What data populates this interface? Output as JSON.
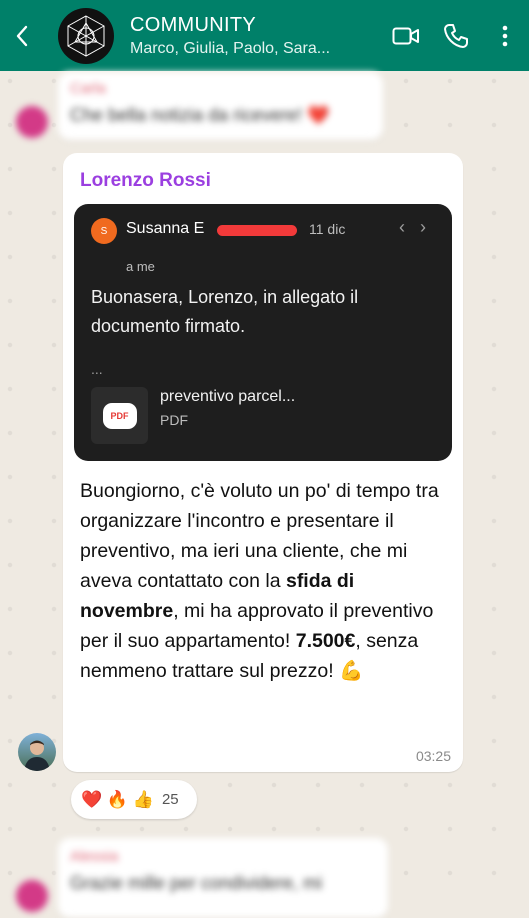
{
  "header": {
    "title": "COMMUNITY",
    "subtitle": "Marco, Giulia, Paolo, Sara..."
  },
  "blurred_top": {
    "sender": "Carla",
    "text": "Che bella notizia da ricevere! ❤️"
  },
  "main_message": {
    "sender": "Lorenzo Rossi",
    "quote": {
      "avatar_letter": "S",
      "sender_name": "Susanna E",
      "date": "11 dic",
      "recipient": "a me",
      "body": "Buonasera, Lorenzo, in allegato il documento firmato.",
      "ellipsis": "...",
      "file_name": "preventivo parcel...",
      "file_type": "PDF",
      "file_icon_label": "PDF"
    },
    "text_parts": [
      "Buongiorno, c'è voluto un po' di tempo tra organizzare l'incontro e presentare il preventivo, ma ieri una cliente, che mi aveva contattato con la ",
      "sfida di novembre",
      ", mi ha approvato il preventivo per il suo appartamento! ",
      "7.500€",
      ", senza nemmeno trattare sul prezzo! 💪"
    ],
    "time": "03:25"
  },
  "reactions": {
    "emojis": "❤️ 🔥 👍",
    "count": "25"
  },
  "blurred_bottom": {
    "sender": "Alessia",
    "text": "Grazie mille per condividere, mi"
  },
  "colors": {
    "header": "#008069",
    "sender": "#9b3fe0",
    "quote_bg": "#1e1e1e"
  }
}
